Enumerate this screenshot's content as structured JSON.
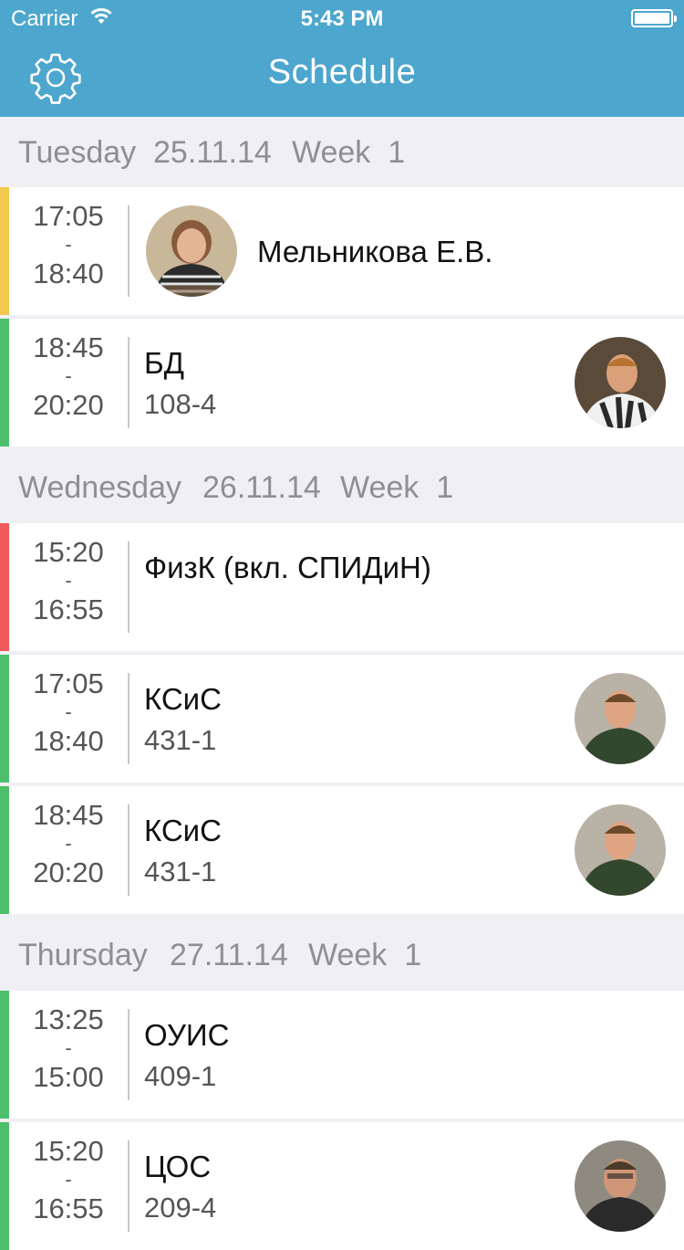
{
  "status_bar": {
    "carrier": "Carrier",
    "time": "5:43 PM"
  },
  "nav": {
    "title": "Schedule"
  },
  "days": [
    {
      "weekday": "Tuesday",
      "date": "25.11.14",
      "week": "Week  1"
    },
    {
      "weekday": "Wednesday",
      "date": "26.11.14",
      "week": "Week  1"
    },
    {
      "weekday": "Thursday",
      "date": "27.11.14",
      "week": "Week  1"
    }
  ],
  "lessons": [
    {
      "start": "17:05",
      "end": "18:40",
      "teacher": "Мельникова Е.В.",
      "color": "#f2c94c",
      "avatar": "teacher-woman"
    },
    {
      "start": "18:45",
      "end": "20:20",
      "subject": "БД",
      "room": "108-4",
      "color": "#4cbf6b",
      "avatar": "teacher-man-1"
    },
    {
      "start": "15:20",
      "end": "16:55",
      "subject": "ФизК (вкл. СПИДиН)",
      "room": "",
      "color": "#f25a5a"
    },
    {
      "start": "17:05",
      "end": "18:40",
      "subject": "КСиС",
      "room": "431-1",
      "color": "#4cbf6b",
      "avatar": "teacher-man-2"
    },
    {
      "start": "18:45",
      "end": "20:20",
      "subject": "КСиС",
      "room": "431-1",
      "color": "#4cbf6b",
      "avatar": "teacher-man-2"
    },
    {
      "start": "13:25",
      "end": "15:00",
      "subject": "ОУИС",
      "room": "409-1",
      "color": "#4cbf6b"
    },
    {
      "start": "15:20",
      "end": "16:55",
      "subject": "ЦОС",
      "room": "209-4",
      "color": "#4cbf6b",
      "avatar": "teacher-man-3"
    }
  ],
  "dash": "-"
}
